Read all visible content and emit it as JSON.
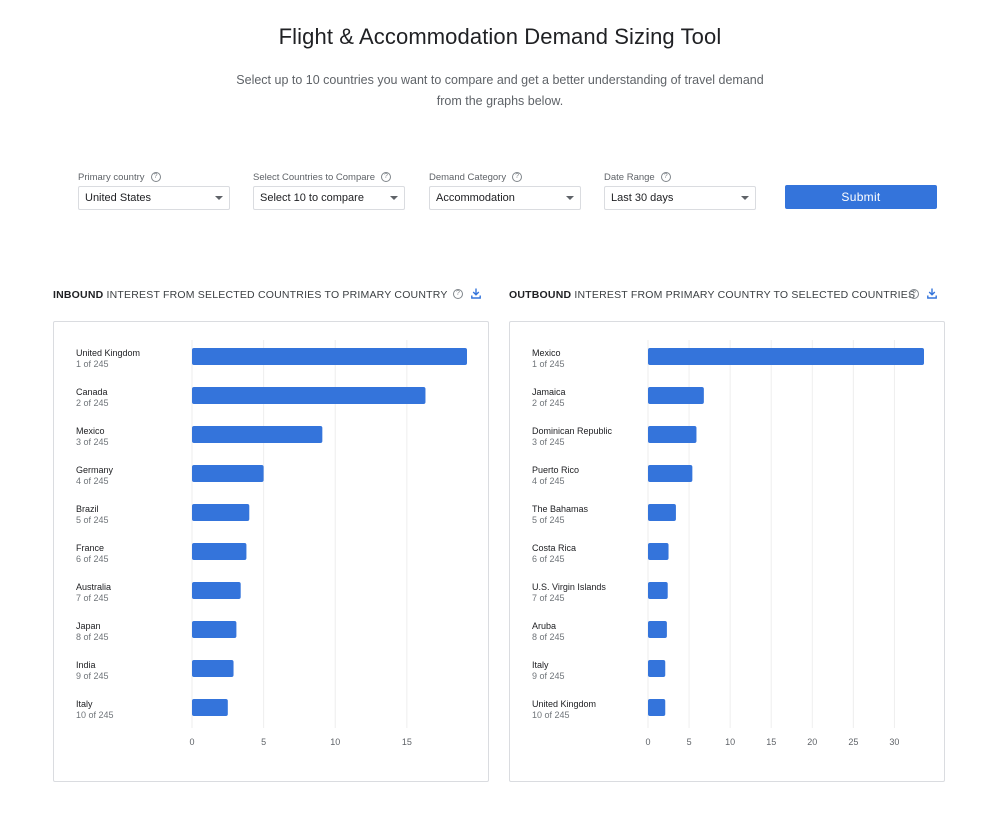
{
  "header": {
    "title": "Flight & Accommodation Demand Sizing Tool",
    "subtitle": "Select up to 10 countries you want to compare and get a better understanding of travel demand from the graphs below."
  },
  "filters": [
    {
      "label": "Primary country",
      "value": "United States"
    },
    {
      "label": "Select Countries to Compare",
      "value": "Select 10 to compare"
    },
    {
      "label": "Demand Category",
      "value": "Accommodation"
    },
    {
      "label": "Date Range",
      "value": "Last 30 days"
    }
  ],
  "submit_label": "Submit",
  "colors": {
    "accent": "#3474db",
    "gridline": "#eeeeee",
    "border": "#dadce0"
  },
  "icons": {
    "help": "help-circle-icon",
    "download": "download-icon"
  },
  "chart_data": [
    {
      "type": "bar",
      "orientation": "horizontal",
      "title_bold": "INBOUND",
      "title_rest": "INTEREST FROM SELECTED COUNTRIES TO PRIMARY COUNTRY",
      "categories": [
        "United Kingdom",
        "Canada",
        "Mexico",
        "Germany",
        "Brazil",
        "France",
        "Australia",
        "Japan",
        "India",
        "Italy"
      ],
      "ranks": [
        "1 of 245",
        "2 of 245",
        "3 of 245",
        "4 of 245",
        "5 of 245",
        "6 of 245",
        "7 of 245",
        "8 of 245",
        "9 of 245",
        "10 of 245"
      ],
      "values": [
        19.2,
        16.3,
        9.1,
        5.0,
        4.0,
        3.8,
        3.4,
        3.1,
        2.9,
        2.5
      ],
      "xticks": [
        0,
        5,
        10,
        15
      ],
      "xlim": [
        0,
        19.2
      ],
      "grid": true,
      "color": "#3474db"
    },
    {
      "type": "bar",
      "orientation": "horizontal",
      "title_bold": "OUTBOUND",
      "title_rest": "INTEREST FROM PRIMARY COUNTRY TO SELECTED COUNTRIES",
      "categories": [
        "Mexico",
        "Jamaica",
        "Dominican Republic",
        "Puerto Rico",
        "The Bahamas",
        "Costa Rica",
        "U.S. Virgin Islands",
        "Aruba",
        "Italy",
        "United Kingdom"
      ],
      "ranks": [
        "1 of 245",
        "2 of 245",
        "3 of 245",
        "4 of 245",
        "5 of 245",
        "6 of 245",
        "7 of 245",
        "8 of 245",
        "9 of 245",
        "10 of 245"
      ],
      "values": [
        33.6,
        6.8,
        5.9,
        5.4,
        3.4,
        2.5,
        2.4,
        2.3,
        2.1,
        2.1
      ],
      "xticks": [
        0,
        5,
        10,
        15,
        20,
        25,
        30
      ],
      "xlim": [
        0,
        33.6
      ],
      "grid": true,
      "color": "#3474db"
    }
  ]
}
